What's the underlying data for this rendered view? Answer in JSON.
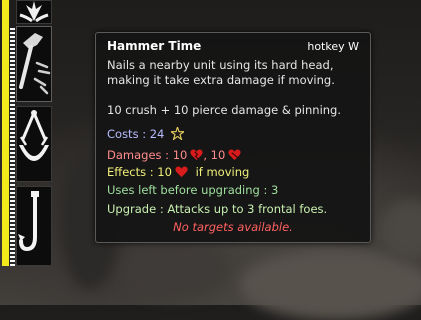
{
  "tooltip": {
    "title": "Hammer Time",
    "hotkey": "hotkey W",
    "desc_line1": "Nails a nearby unit using its hard head,",
    "desc_line2": "making it take extra damage if moving.",
    "summary": "10 crush + 10 pierce damage & pinning.",
    "costs_label": "Costs : 24",
    "damages_label": "Damages : 10",
    "damages_sep": ", 10",
    "effects_label": "Effects : 10",
    "effects_suffix": "if moving",
    "uses_left": "Uses left before upgrading : 3",
    "upgrade": "Upgrade : Attacks up to 3 frontal foes.",
    "status": "No targets available."
  },
  "abilities": [
    {
      "icon": "leaf-icon"
    },
    {
      "icon": "hammer-nails-icon"
    },
    {
      "icon": "swing-arc-icon"
    },
    {
      "icon": "hook-icon"
    }
  ],
  "colors": {
    "title": "#ffffff",
    "body": "#e6e6e6",
    "costs": "#b8bcff",
    "damages": "#ff8c8c",
    "effects": "#f0f07a",
    "uses": "#9fe09f",
    "upgrade": "#c8f0b0",
    "status": "#ff6060",
    "health": "#f2ea1a",
    "heart": "#d81c1c"
  }
}
